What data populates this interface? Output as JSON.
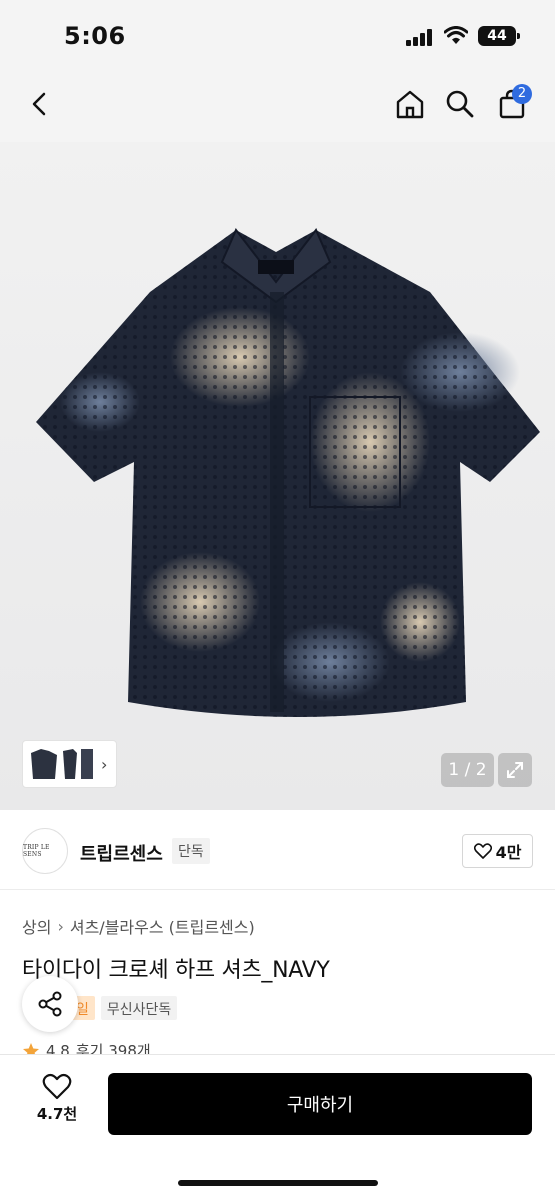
{
  "status": {
    "time": "5:06",
    "battery": "44"
  },
  "nav": {
    "cart_count": "2"
  },
  "gallery": {
    "counter": "1 / 2"
  },
  "brand": {
    "logo_text": "TRIP LE SENS",
    "name": "트립르센스",
    "tag": "단독",
    "likes": "4만"
  },
  "breadcrumb": [
    "상의",
    "셔츠/블라우스 (트립르센스)"
  ],
  "product": {
    "title": "타이다이 크로셰 하프 셔츠_NAVY",
    "badge_sale": "일",
    "badge_exclusive": "무신사단독",
    "rating_value": "4.8",
    "reviews": "후기 398개"
  },
  "bottom": {
    "wish_count": "4.7천",
    "buy_label": "구매하기"
  },
  "colors": {
    "accent": "#2f6bdf",
    "buy_bg": "#000000",
    "rating_star": "#f3a43a"
  }
}
